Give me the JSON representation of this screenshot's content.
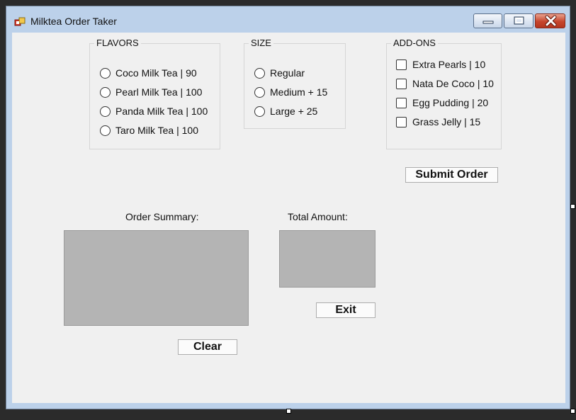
{
  "window": {
    "title": "Milktea Order Taker",
    "icon": "form-app-icon"
  },
  "flavors": {
    "title": "FLAVORS",
    "options": [
      "Coco Milk Tea | 90",
      "Pearl Milk Tea | 100",
      "Panda Milk Tea | 100",
      "Taro Milk Tea | 100"
    ]
  },
  "size": {
    "title": "SIZE",
    "options": [
      "Regular",
      "Medium + 15",
      "Large + 25"
    ]
  },
  "addons": {
    "title": "ADD-ONS",
    "options": [
      "Extra Pearls | 10",
      "Nata De Coco | 10",
      "Egg Pudding | 20",
      "Grass Jelly | 15"
    ]
  },
  "buttons": {
    "submit": "Submit Order",
    "exit": "Exit",
    "clear": "Clear"
  },
  "summary": {
    "order_label": "Order Summary:",
    "total_label": "Total Amount:"
  }
}
